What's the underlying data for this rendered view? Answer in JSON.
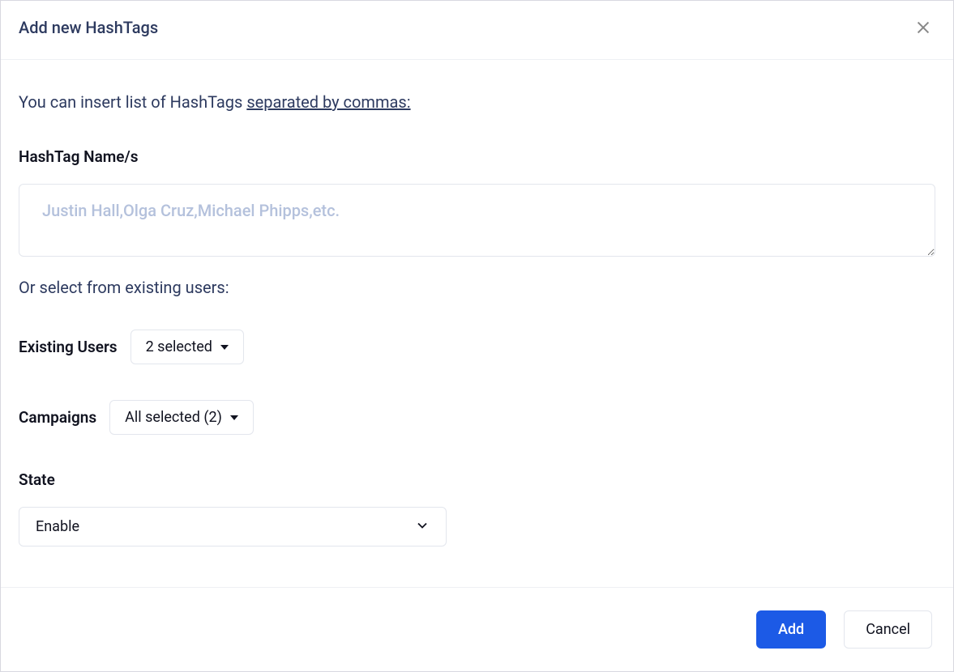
{
  "header": {
    "title": "Add new HashTags"
  },
  "intro": {
    "prefix": "You can insert list of HashTags ",
    "underlined": "separated by commas:"
  },
  "fields": {
    "hashtag_label": "HashTag Name/s",
    "hashtag_placeholder": "Justin Hall,Olga Cruz,Michael Phipps,etc.",
    "or_select_text": "Or select from existing users:",
    "existing_users_label": "Existing Users",
    "existing_users_value": "2 selected",
    "campaigns_label": "Campaigns",
    "campaigns_value": "All selected (2)",
    "state_label": "State",
    "state_value": "Enable"
  },
  "footer": {
    "add_label": "Add",
    "cancel_label": "Cancel"
  }
}
